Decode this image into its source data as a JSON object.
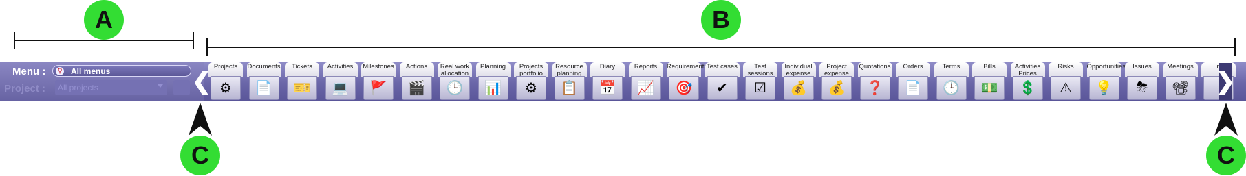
{
  "annotations": {
    "a": "A",
    "b": "B",
    "c_left": "C",
    "c_right": "C"
  },
  "menu": {
    "label": "Menu :",
    "value": "All menus"
  },
  "project": {
    "label": "Project :",
    "value": "All projects"
  },
  "tabs": [
    {
      "label": "Projects",
      "icon": "gear-icon",
      "glyph": "⚙"
    },
    {
      "label": "Documents",
      "icon": "document-icon",
      "glyph": "📄"
    },
    {
      "label": "Tickets",
      "icon": "ticket-icon",
      "glyph": "🎫"
    },
    {
      "label": "Activities",
      "icon": "computer-icon",
      "glyph": "💻"
    },
    {
      "label": "Milestones",
      "icon": "flag-icon",
      "glyph": "🚩"
    },
    {
      "label": "Actions",
      "icon": "clapperboard-icon",
      "glyph": "🎬"
    },
    {
      "label": "Real work allocation",
      "icon": "clock-screen-icon",
      "glyph": "🕒"
    },
    {
      "label": "Planning",
      "icon": "gantt-icon",
      "glyph": "📊"
    },
    {
      "label": "Projects portfolio",
      "icon": "portfolio-gear-icon",
      "glyph": "⚙"
    },
    {
      "label": "Resource planning",
      "icon": "resource-planning-icon",
      "glyph": "📋"
    },
    {
      "label": "Diary",
      "icon": "calendar-clock-icon",
      "glyph": "📅"
    },
    {
      "label": "Reports",
      "icon": "pie-chart-icon",
      "glyph": "📈"
    },
    {
      "label": "Requirements",
      "icon": "target-icon",
      "glyph": "🎯"
    },
    {
      "label": "Test cases",
      "icon": "checkmark-icon",
      "glyph": "✔"
    },
    {
      "label": "Test sessions",
      "icon": "checklist-icon",
      "glyph": "☑"
    },
    {
      "label": "Individual expense",
      "icon": "money-bag-person-icon",
      "glyph": "💰"
    },
    {
      "label": "Project expense",
      "icon": "money-bag-gear-icon",
      "glyph": "💰"
    },
    {
      "label": "Quotations",
      "icon": "quotation-icon",
      "glyph": "❓"
    },
    {
      "label": "Orders",
      "icon": "order-icon",
      "glyph": "📄"
    },
    {
      "label": "Terms",
      "icon": "term-clock-icon",
      "glyph": "🕒"
    },
    {
      "label": "Bills",
      "icon": "bill-icon",
      "glyph": "💵"
    },
    {
      "label": "Activities Prices",
      "icon": "activity-price-icon",
      "glyph": "💲"
    },
    {
      "label": "Risks",
      "icon": "risk-icon",
      "glyph": "⚠"
    },
    {
      "label": "Opportunities",
      "icon": "lightbulb-icon",
      "glyph": "💡"
    },
    {
      "label": "Issues",
      "icon": "storm-icon",
      "glyph": "⛈"
    },
    {
      "label": "Meetings",
      "icon": "presentation-icon",
      "glyph": "📽"
    },
    {
      "label": "n",
      "icon": "partial-icon",
      "glyph": ""
    }
  ]
}
